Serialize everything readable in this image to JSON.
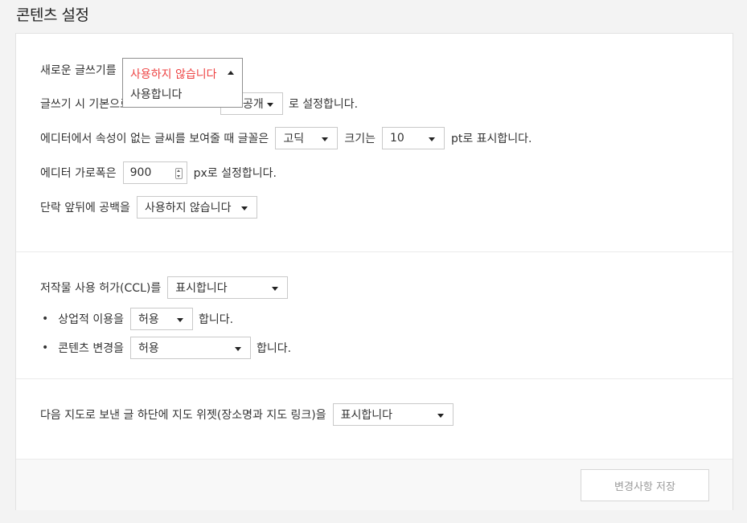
{
  "page_title": "콘텐츠 설정",
  "editor": {
    "new_editor_label": "새로운 글쓰기를",
    "new_editor_dropdown": {
      "selected": "사용하지 않습니다",
      "options": [
        "사용합니다"
      ]
    },
    "default_visibility_label": "글쓰기 시 기본으로",
    "default_visibility_value": "공개",
    "default_visibility_suffix": "로 설정합니다.",
    "font_label": "에디터에서 속성이 없는 글씨를 보여줄 때 글꼴은",
    "font_value": "고딕",
    "size_label": "크기는",
    "size_value": "10",
    "size_suffix": "pt로 표시합니다.",
    "width_label": "에디터 가로폭은",
    "width_value": "900",
    "width_suffix": "px로 설정합니다.",
    "paragraph_label": "단락 앞뒤에 공백을",
    "paragraph_value": "사용하지 않습니다"
  },
  "ccl": {
    "label": "저작물 사용 허가(CCL)를",
    "value": "표시합니다",
    "commercial_label": "상업적 이용을",
    "commercial_value": "허용",
    "commercial_suffix": "합니다.",
    "modify_label": "콘텐츠 변경을",
    "modify_value": "허용",
    "modify_suffix": "합니다.",
    "bullet": "•"
  },
  "map": {
    "label": "다음 지도로 보낸 글 하단에 지도 위젯(장소명과 지도 링크)을",
    "value": "표시합니다"
  },
  "footer": {
    "save_label": "변경사항 저장"
  }
}
